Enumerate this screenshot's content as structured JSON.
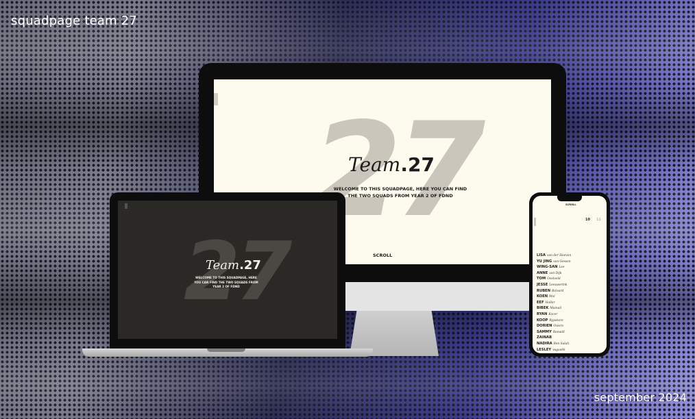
{
  "header": {
    "title": "squadpage  team 27"
  },
  "footer": {
    "date": "september 2024"
  },
  "site": {
    "number": "27",
    "brand_script": "Team",
    "brand_bold": ".27",
    "welcome": "WELCOME TO THIS SQUADPAGE, HERE YOU CAN FIND THE TWO SQUADS FROM YEAR 2 OF FDND",
    "scroll_label": "SCROLL"
  },
  "phone": {
    "scroll_label": "SCROLL",
    "squad_a": "10",
    "squad_b": "11",
    "members": [
      {
        "first": "LISA",
        "last": "van der Hoeven"
      },
      {
        "first": "YU JING",
        "last": "van Gessen"
      },
      {
        "first": "WING-SAN",
        "last": "Lee"
      },
      {
        "first": "ANNE",
        "last": "van Dijk"
      },
      {
        "first": "TOM",
        "last": "Oostveld"
      },
      {
        "first": "JESSE",
        "last": "Leeuwerink"
      },
      {
        "first": "RUBEN",
        "last": "Bolvard"
      },
      {
        "first": "KOEN",
        "last": "Mol"
      },
      {
        "first": "EEF",
        "last": "Holler"
      },
      {
        "first": "BIBEK",
        "last": "Mainali"
      },
      {
        "first": "RYAN",
        "last": "Kocer"
      },
      {
        "first": "KOOP",
        "last": "Rypskers"
      },
      {
        "first": "DORIEN",
        "last": "Owers"
      },
      {
        "first": "SAMMY",
        "last": "Baouidi"
      },
      {
        "first": "ZAINAB",
        "last": ""
      },
      {
        "first": "NADIRA",
        "last": "Ben Salah"
      },
      {
        "first": "LESLEY",
        "last": "vagaakk"
      }
    ]
  }
}
